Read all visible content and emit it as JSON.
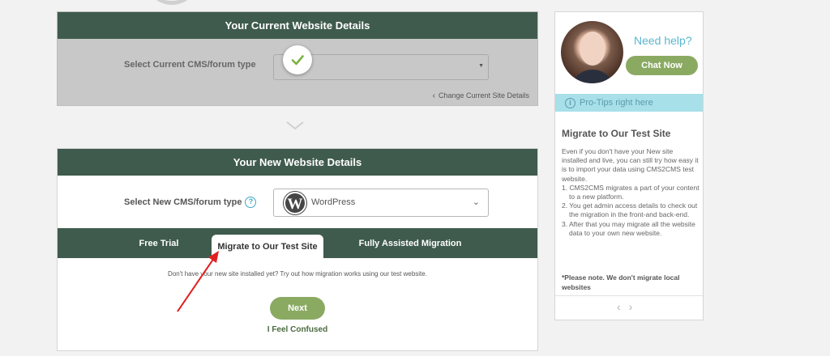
{
  "current_site": {
    "title": "Your Current Website Details",
    "cms_label": "Select Current CMS/forum type",
    "cms_value": "",
    "change_link": "Change Current Site Details"
  },
  "new_site": {
    "title": "Your New Website Details",
    "cms_label": "Select New CMS/forum type",
    "help_icon": "?",
    "cms_value": "WordPress",
    "cms_icon": "wordpress-icon",
    "cms_icon_glyph": "W"
  },
  "tabs": {
    "free_trial": "Free Trial",
    "test_site": "Migrate to Our Test Site",
    "fully_assisted": "Fully Assisted Migration",
    "active": "test_site"
  },
  "test_site_panel": {
    "description": "Don't have your new site installed yet? Try out how migration works using our test website.",
    "next_label": "Next",
    "confused_label": "I Feel Confused"
  },
  "help_card": {
    "need_help": "Need help?",
    "chat_label": "Chat Now",
    "protips_icon": "i",
    "protips_label": "Pro-Tips right here",
    "tip_title": "Migrate to Our Test Site",
    "tip_intro": "Even if you don't have your New site installed and live, you can still try how easy it is to import your data using CMS2CMS test website.",
    "tip_steps": [
      "1. CMS2CMS migrates a part of your content to a new platform.",
      "2. You get admin access details to check out the migration in the front-and back-end.",
      "3. After that you may migrate all the website data to your own new website."
    ],
    "tip_note": "*Please note. We don't migrate local websites",
    "nav_prev": "‹",
    "nav_next": "›"
  },
  "colors": {
    "header_green": "#3f5b4d",
    "button_green": "#8aaa62",
    "accent_blue": "#5bb5cf",
    "protips_bg": "#a8e0ea",
    "annotation_red": "#e02020"
  }
}
